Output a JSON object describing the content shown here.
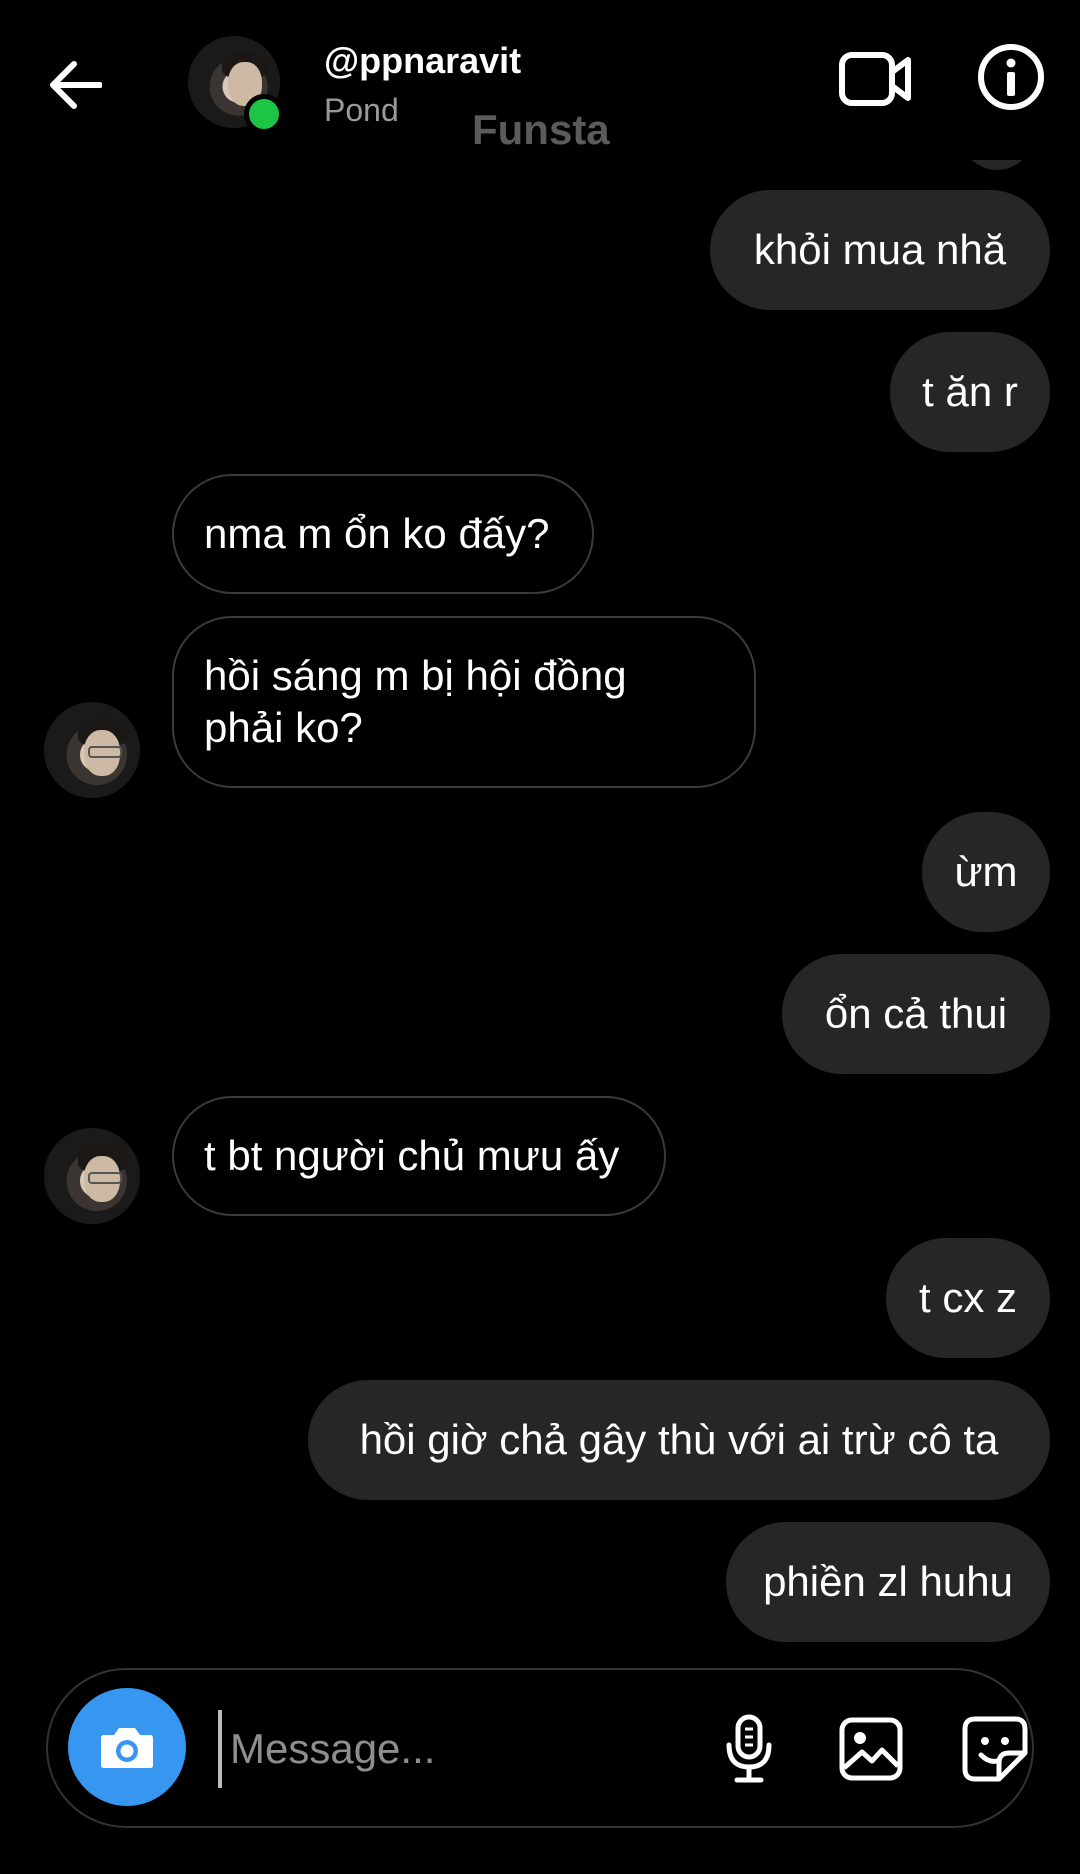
{
  "header": {
    "username": "@ppnaravit",
    "subname": "Pond",
    "watermark": "Funsta"
  },
  "messages": [
    {
      "side": "out",
      "text": "khỏi mua nhă"
    },
    {
      "side": "out",
      "text": "t ăn r"
    },
    {
      "side": "in",
      "text": "nma m ổn ko đấy?"
    },
    {
      "side": "in",
      "text": "hồi sáng m bị hội đồng phải ko?"
    },
    {
      "side": "out",
      "text": "ừm"
    },
    {
      "side": "out",
      "text": "ổn cả thui"
    },
    {
      "side": "in",
      "text": "t bt người chủ mưu ấy"
    },
    {
      "side": "out",
      "text": "t cx z"
    },
    {
      "side": "out",
      "text": "hồi giờ chả gây thù với ai trừ cô ta"
    },
    {
      "side": "out",
      "text": "phiền zl huhu"
    }
  ],
  "composer": {
    "placeholder": "Message..."
  },
  "colors": {
    "accent": "#3797f0",
    "online": "#1ec443",
    "outgoing_bubble": "#262626",
    "background": "#000000"
  },
  "icons": {
    "back": "arrow-left-icon",
    "video": "video-camera-icon",
    "info": "info-icon",
    "camera": "camera-icon",
    "mic": "microphone-icon",
    "gallery": "image-icon",
    "sticker": "sticker-icon"
  }
}
